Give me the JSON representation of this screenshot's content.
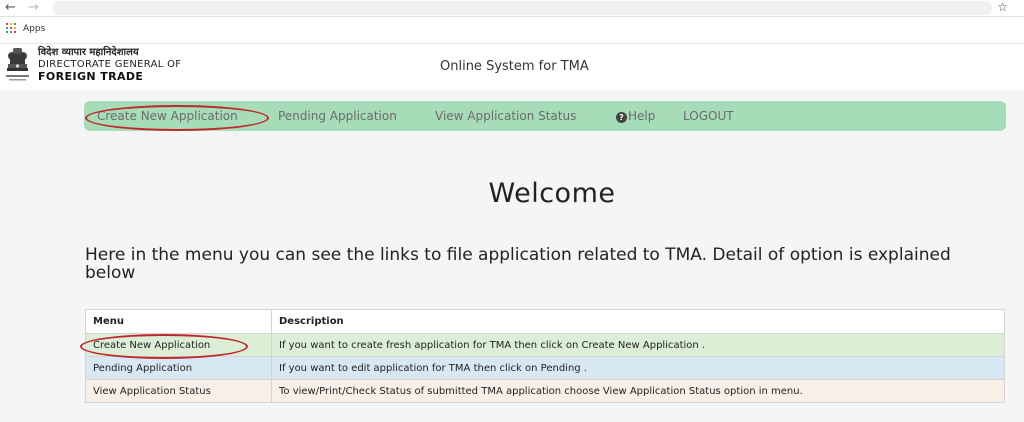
{
  "browser": {
    "back_icon": "arrow-left-icon",
    "forward_icon": "arrow-right-icon",
    "bookmark_icon": "star-icon",
    "apps_label": "Apps",
    "apps_colors": [
      "#e94235",
      "#fbbc04",
      "#34a853",
      "#4285f4",
      "#e94235",
      "#fbbc04",
      "#34a853",
      "#4285f4",
      "#e94235"
    ]
  },
  "header": {
    "logo_hindi": "विदेश व्यापार महानिदेशालय",
    "logo_line2": "DIRECTORATE GENERAL OF",
    "logo_line3": "FOREIGN TRADE",
    "system_title": "Online System for TMA"
  },
  "menu": {
    "create": "Create New Application",
    "pending": "Pending Application",
    "status": "View Application Status",
    "help": "Help",
    "help_glyph": "?",
    "logout": "LOGOUT",
    "bar_color": "#a7dcb8"
  },
  "content": {
    "welcome": "Welcome",
    "intro": "Here in the menu you can see the links to file application related to TMA. Detail of option is explained below"
  },
  "table": {
    "headers": [
      "Menu",
      "Description"
    ],
    "rows": [
      {
        "menu": "Create New Application",
        "description": "If you want to create fresh application for TMA then click on Create New Application ."
      },
      {
        "menu": "Pending Application",
        "description": "If you want to edit application for TMA then click on Pending ."
      },
      {
        "menu": "View Application Status",
        "description": "To view/Print/Check Status of submitted TMA application choose View Application Status option in menu."
      }
    ]
  },
  "annotation_color": "#c0272d"
}
